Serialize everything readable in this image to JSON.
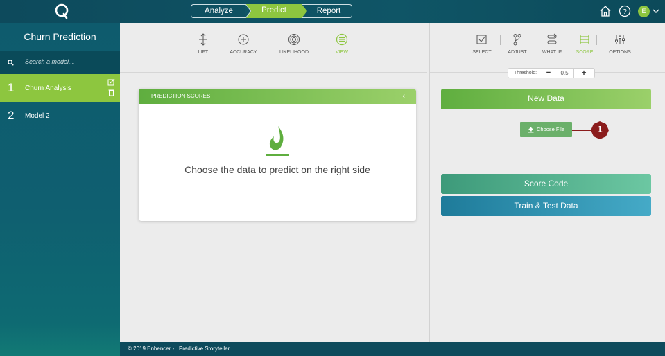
{
  "topbar": {
    "logo_letter": "Q",
    "steps": [
      {
        "label": "Analyze",
        "state": "inactive"
      },
      {
        "label": "Predict",
        "state": "active"
      },
      {
        "label": "Report",
        "state": "inactive"
      }
    ],
    "icons": [
      "home-icon",
      "help-icon"
    ],
    "user_initial": "E",
    "accent_color": "#8dc63f"
  },
  "sidebar": {
    "title": "Churn Prediction",
    "search_placeholder": "Search a model...",
    "models": [
      {
        "number": "1",
        "name": "Churn Analysis",
        "selected": true
      },
      {
        "number": "2",
        "name": "Model 2",
        "selected": false
      }
    ]
  },
  "middle": {
    "tools": [
      {
        "label": "LIFT",
        "icon": "lift-icon",
        "active": false
      },
      {
        "label": "ACCURACY",
        "icon": "accuracy-icon",
        "active": false
      },
      {
        "label": "LIKELIHOOD",
        "icon": "likelihood-icon",
        "active": false
      },
      {
        "label": "VIEW",
        "icon": "view-icon",
        "active": true
      }
    ],
    "card": {
      "title": "PREDICTION SCORES",
      "collapse_glyph": "‹",
      "message": "Choose the data to predict on the right side"
    }
  },
  "right": {
    "tools": [
      {
        "label": "SELECT",
        "icon": "select-icon",
        "active": false
      },
      {
        "label": "ADJUST",
        "icon": "adjust-icon",
        "active": false
      },
      {
        "label": "WHAT IF",
        "icon": "what-if-icon",
        "active": false
      },
      {
        "label": "SCORE",
        "icon": "score-icon",
        "active": true
      },
      {
        "label": "OPTIONS",
        "icon": "options-icon",
        "active": false
      }
    ],
    "threshold": {
      "label": "Threshold:",
      "value": "0.5",
      "minus": "−",
      "plus": "+"
    },
    "sections": {
      "new_data": "New Data",
      "choose_file": "Choose File",
      "score_code": "Score Code",
      "train_test": "Train & Test Data"
    },
    "callout_number": "1"
  },
  "footer": {
    "text": "© 2019 Enhencer -   Predictive Storyteller"
  }
}
